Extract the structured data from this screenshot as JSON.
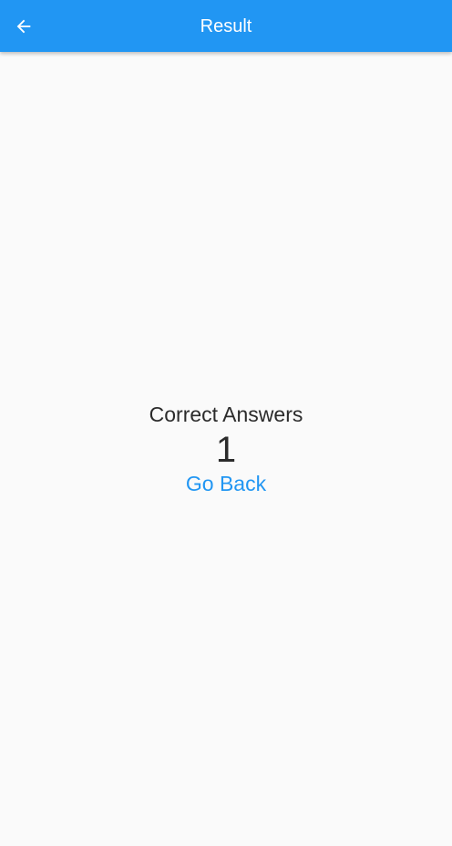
{
  "app_bar": {
    "title": "Result",
    "back_icon": "arrow-back-icon",
    "background_color": "#2196f3",
    "title_color": "#ffffff"
  },
  "result": {
    "label": "Correct Answers",
    "count": "1",
    "go_back_label": "Go Back",
    "link_color": "#2196f3"
  }
}
